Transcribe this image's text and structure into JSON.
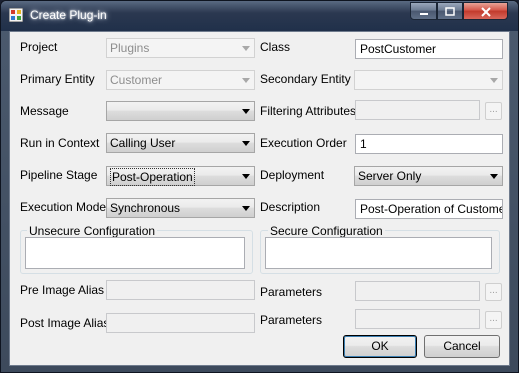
{
  "window": {
    "title": "Create Plug-in",
    "icon": "plugin-app-icon",
    "controls": {
      "minimize": "minimize-icon",
      "maximize": "maximize-icon",
      "close": "close-icon"
    }
  },
  "form": {
    "project": {
      "label": "Project",
      "value": "Plugins"
    },
    "class": {
      "label": "Class",
      "value": "PostCustomer"
    },
    "primary_entity": {
      "label": "Primary Entity",
      "value": "Customer"
    },
    "secondary_entity": {
      "label": "Secondary Entity",
      "value": ""
    },
    "message": {
      "label": "Message",
      "value": ""
    },
    "filtering_attributes": {
      "label": "Filtering Attributes",
      "value": "",
      "browse": "..."
    },
    "run_in_context": {
      "label": "Run in Context",
      "value": "Calling User"
    },
    "execution_order": {
      "label": "Execution Order",
      "value": "1"
    },
    "pipeline_stage": {
      "label": "Pipeline Stage",
      "value": "Post-Operation"
    },
    "deployment": {
      "label": "Deployment",
      "value": "Server Only"
    },
    "execution_mode": {
      "label": "Execution Mode",
      "value": "Synchronous"
    },
    "description": {
      "label": "Description",
      "value": "Post-Operation of Customer"
    },
    "unsecure_configuration": {
      "label": "Unsecure Configuration",
      "value": ""
    },
    "secure_configuration": {
      "label": "Secure Configuration",
      "value": ""
    },
    "pre_image_alias": {
      "label": "Pre Image Alias",
      "value": ""
    },
    "pre_image_parameters": {
      "label": "Parameters",
      "value": "",
      "browse": "..."
    },
    "post_image_alias": {
      "label": "Post Image Alias",
      "value": ""
    },
    "post_image_parameters": {
      "label": "Parameters",
      "value": "",
      "browse": "..."
    }
  },
  "buttons": {
    "ok": "OK",
    "cancel": "Cancel"
  }
}
